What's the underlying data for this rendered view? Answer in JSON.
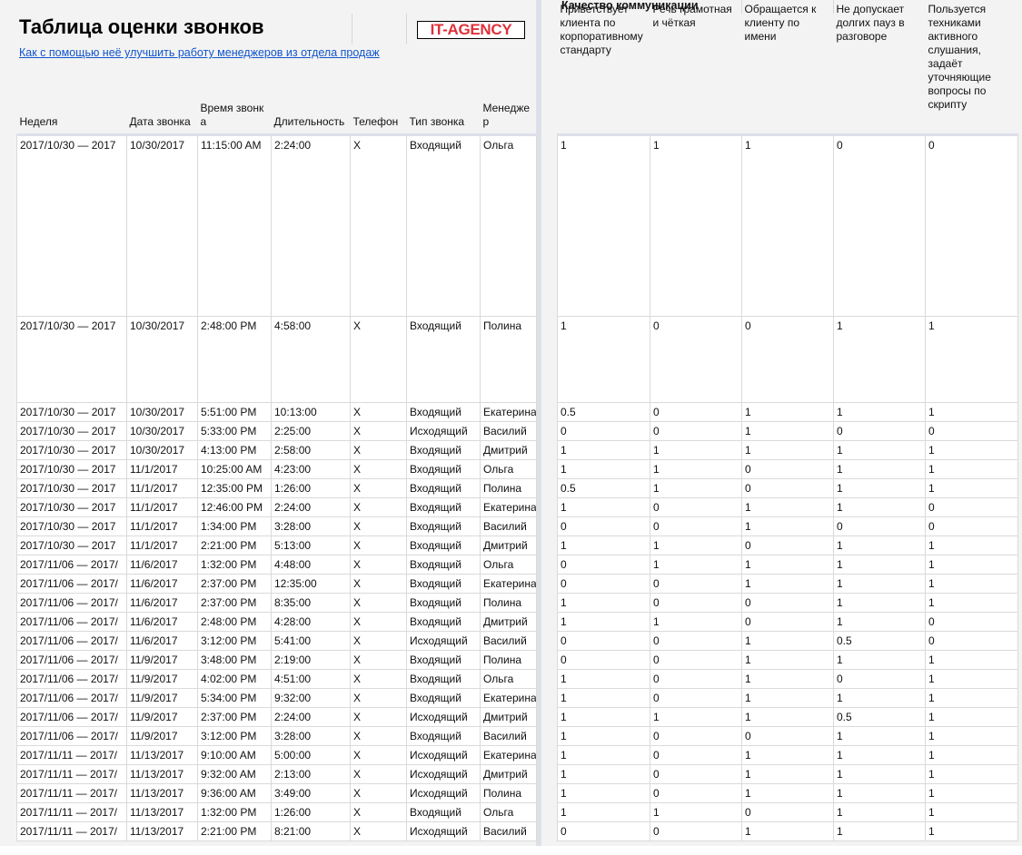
{
  "title": "Таблица оценки звонков",
  "link": "Как с помощью неё улучшить работу менеджеров из отдела продаж",
  "logo": "IT-AGENCY",
  "colors": {
    "link": "#1155cc",
    "logo": "#e0303a"
  },
  "left_headers": [
    "Неделя",
    "Дата звонка",
    "Время звонка",
    "Длительность",
    "Телефон",
    "Тип звонка",
    "Менеджер"
  ],
  "group_header": "Качество коммуникации",
  "right_headers": [
    "Приветствует клиента по корпоративному стандарту",
    "Речь грамотная и чёткая",
    "Обращается к клиенту по имени",
    "Не допускает долгих пауз в разговоре",
    "Пользуется техниками активного слушания, задаёт уточняющие вопросы по скрипту"
  ],
  "rows": [
    [
      "2017/10/30 — 2017",
      "10/30/2017",
      "11:15:00 AM",
      "2:24:00",
      "X",
      "Входящий",
      "Ольга",
      "1",
      "1",
      "1",
      "0",
      "0"
    ],
    [
      "2017/10/30 — 2017",
      "10/30/2017",
      "2:48:00 PM",
      "4:58:00",
      "X",
      "Входящий",
      "Полина",
      "1",
      "0",
      "0",
      "1",
      "1"
    ],
    [
      "2017/10/30 — 2017",
      "10/30/2017",
      "5:51:00 PM",
      "10:13:00",
      "X",
      "Входящий",
      "Екатерина",
      "0.5",
      "0",
      "1",
      "1",
      "1"
    ],
    [
      "2017/10/30 — 2017",
      "10/30/2017",
      "5:33:00 PM",
      "2:25:00",
      "X",
      "Исходящий",
      "Василий",
      "0",
      "0",
      "1",
      "0",
      "0"
    ],
    [
      "2017/10/30 — 2017",
      "10/30/2017",
      "4:13:00 PM",
      "2:58:00",
      "X",
      "Входящий",
      "Дмитрий",
      "1",
      "1",
      "1",
      "1",
      "1"
    ],
    [
      "2017/10/30 — 2017",
      "11/1/2017",
      "10:25:00 AM",
      "4:23:00",
      "X",
      "Входящий",
      "Ольга",
      "1",
      "1",
      "0",
      "1",
      "1"
    ],
    [
      "2017/10/30 — 2017",
      "11/1/2017",
      "12:35:00 PM",
      "1:26:00",
      "X",
      "Входящий",
      "Полина",
      "0.5",
      "1",
      "0",
      "1",
      "1"
    ],
    [
      "2017/10/30 — 2017",
      "11/1/2017",
      "12:46:00 PM",
      "2:24:00",
      "X",
      "Входящий",
      "Екатерина",
      "1",
      "0",
      "1",
      "1",
      "0"
    ],
    [
      "2017/10/30 — 2017",
      "11/1/2017",
      "1:34:00 PM",
      "3:28:00",
      "X",
      "Входящий",
      "Василий",
      "0",
      "0",
      "1",
      "0",
      "0"
    ],
    [
      "2017/10/30 — 2017",
      "11/1/2017",
      "2:21:00 PM",
      "5:13:00",
      "X",
      "Входящий",
      "Дмитрий",
      "1",
      "1",
      "0",
      "1",
      "1"
    ],
    [
      "2017/11/06 — 2017/",
      "11/6/2017",
      "1:32:00 PM",
      "4:48:00",
      "X",
      "Входящий",
      "Ольга",
      "0",
      "1",
      "1",
      "1",
      "1"
    ],
    [
      "2017/11/06 — 2017/",
      "11/6/2017",
      "2:37:00 PM",
      "12:35:00",
      "X",
      "Входящий",
      "Екатерина",
      "0",
      "0",
      "1",
      "1",
      "1"
    ],
    [
      "2017/11/06 — 2017/",
      "11/6/2017",
      "2:37:00 PM",
      "8:35:00",
      "X",
      "Входящий",
      "Полина",
      "1",
      "0",
      "0",
      "1",
      "1"
    ],
    [
      "2017/11/06 — 2017/",
      "11/6/2017",
      "2:48:00 PM",
      "4:28:00",
      "X",
      "Входящий",
      "Дмитрий",
      "1",
      "1",
      "0",
      "1",
      "0"
    ],
    [
      "2017/11/06 — 2017/",
      "11/6/2017",
      "3:12:00 PM",
      "5:41:00",
      "X",
      "Исходящий",
      "Василий",
      "0",
      "0",
      "1",
      "0.5",
      "0"
    ],
    [
      "2017/11/06 — 2017/",
      "11/9/2017",
      "3:48:00 PM",
      "2:19:00",
      "X",
      "Входящий",
      "Полина",
      "0",
      "0",
      "1",
      "1",
      "1"
    ],
    [
      "2017/11/06 — 2017/",
      "11/9/2017",
      "4:02:00 PM",
      "4:51:00",
      "X",
      "Входящий",
      "Ольга",
      "1",
      "0",
      "1",
      "0",
      "1"
    ],
    [
      "2017/11/06 — 2017/",
      "11/9/2017",
      "5:34:00 PM",
      "9:32:00",
      "X",
      "Входящий",
      "Екатерина",
      "1",
      "0",
      "1",
      "1",
      "1"
    ],
    [
      "2017/11/06 — 2017/",
      "11/9/2017",
      "2:37:00 PM",
      "2:24:00",
      "X",
      "Исходящий",
      "Дмитрий",
      "1",
      "1",
      "1",
      "0.5",
      "1"
    ],
    [
      "2017/11/06 — 2017/",
      "11/9/2017",
      "3:12:00 PM",
      "3:28:00",
      "X",
      "Входящий",
      "Василий",
      "1",
      "0",
      "0",
      "1",
      "1"
    ],
    [
      "2017/11/11 — 2017/",
      "11/13/2017",
      "9:10:00 AM",
      "5:00:00",
      "X",
      "Исходящий",
      "Екатерина",
      "1",
      "0",
      "1",
      "1",
      "1"
    ],
    [
      "2017/11/11 — 2017/",
      "11/13/2017",
      "9:32:00 AM",
      "2:13:00",
      "X",
      "Исходящий",
      "Дмитрий",
      "1",
      "0",
      "1",
      "1",
      "1"
    ],
    [
      "2017/11/11 — 2017/",
      "11/13/2017",
      "9:36:00 AM",
      "3:49:00",
      "X",
      "Исходящий",
      "Полина",
      "1",
      "0",
      "1",
      "1",
      "1"
    ],
    [
      "2017/11/11 — 2017/",
      "11/13/2017",
      "1:32:00 PM",
      "1:26:00",
      "X",
      "Входящий",
      "Ольга",
      "1",
      "1",
      "0",
      "1",
      "1"
    ],
    [
      "2017/11/11 — 2017/",
      "11/13/2017",
      "2:21:00 PM",
      "8:21:00",
      "X",
      "Исходящий",
      "Василий",
      "0",
      "0",
      "1",
      "1",
      "1"
    ]
  ]
}
